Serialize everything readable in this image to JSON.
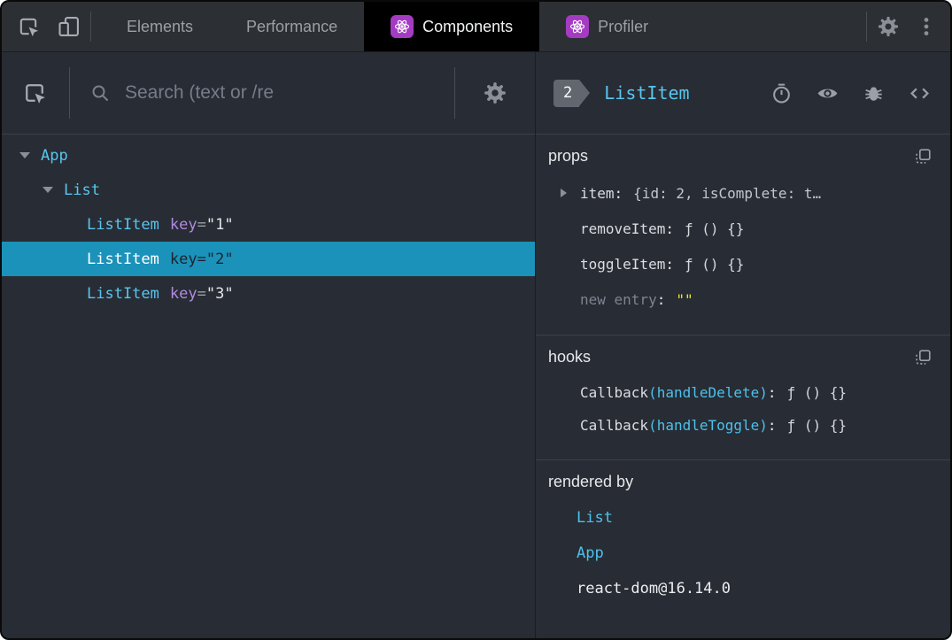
{
  "colors": {
    "panel_background": "#282c34",
    "tabbar_background": "#2c2f33",
    "selected_tab_background": "#000000",
    "accent_cyan": "#59c5ee",
    "selected_row_background": "#1b92ba",
    "key_purple": "#b18ae0",
    "string_yellow": "#ece81a",
    "react_badge_purple": "#a43bc2",
    "icon_gray": "#9aa0a6"
  },
  "icons": {
    "inspect": "cursor-in-box",
    "device_toolbar": "phone-and-tablet",
    "react_logo": "atom",
    "settings": "gear",
    "menu": "kebab-dots",
    "search": "magnifier",
    "suspense_toggle": "stopwatch",
    "inspect_dom": "eye",
    "log_component": "bug",
    "view_source": "angle-brackets",
    "copy": "copy-square",
    "expand_open": "caret-down",
    "expand_closed": "caret-right"
  },
  "tabbar": {
    "tabs": [
      {
        "label": "Elements"
      },
      {
        "label": "Performance"
      },
      {
        "label": "Components"
      },
      {
        "label": "Profiler"
      }
    ]
  },
  "left_panel": {
    "search_placeholder": "Search (text or /re",
    "tree": [
      {
        "label": "App"
      },
      {
        "label": "List"
      },
      {
        "label": "ListItem",
        "key_label": "key",
        "eq": "=",
        "key_value": "\"1\""
      },
      {
        "label": "ListItem",
        "key_label": "key",
        "eq": "=",
        "key_value": "\"2\""
      },
      {
        "label": "ListItem",
        "key_label": "key",
        "eq": "=",
        "key_value": "\"3\""
      }
    ]
  },
  "right_panel": {
    "selected_badge": "2",
    "selected_component": "ListItem",
    "props": {
      "title": "props",
      "rows": [
        {
          "name": "item",
          "sep": ":",
          "value": "{id: 2, isComplete: t…"
        },
        {
          "name": "removeItem",
          "sep": ":",
          "value": "ƒ () {}"
        },
        {
          "name": "toggleItem",
          "sep": ":",
          "value": "ƒ () {}"
        },
        {
          "name": "new entry",
          "sep": ":",
          "value": "\"\""
        }
      ]
    },
    "hooks": {
      "title": "hooks",
      "rows": [
        {
          "name": "Callback",
          "arg": "(handleDelete)",
          "sep": ":",
          "value": "ƒ () {}"
        },
        {
          "name": "Callback",
          "arg": "(handleToggle)",
          "sep": ":",
          "value": "ƒ () {}"
        }
      ]
    },
    "rendered_by": {
      "title": "rendered by",
      "items": [
        {
          "label": "List"
        },
        {
          "label": "App"
        },
        {
          "label": "react-dom@16.14.0"
        }
      ]
    }
  }
}
